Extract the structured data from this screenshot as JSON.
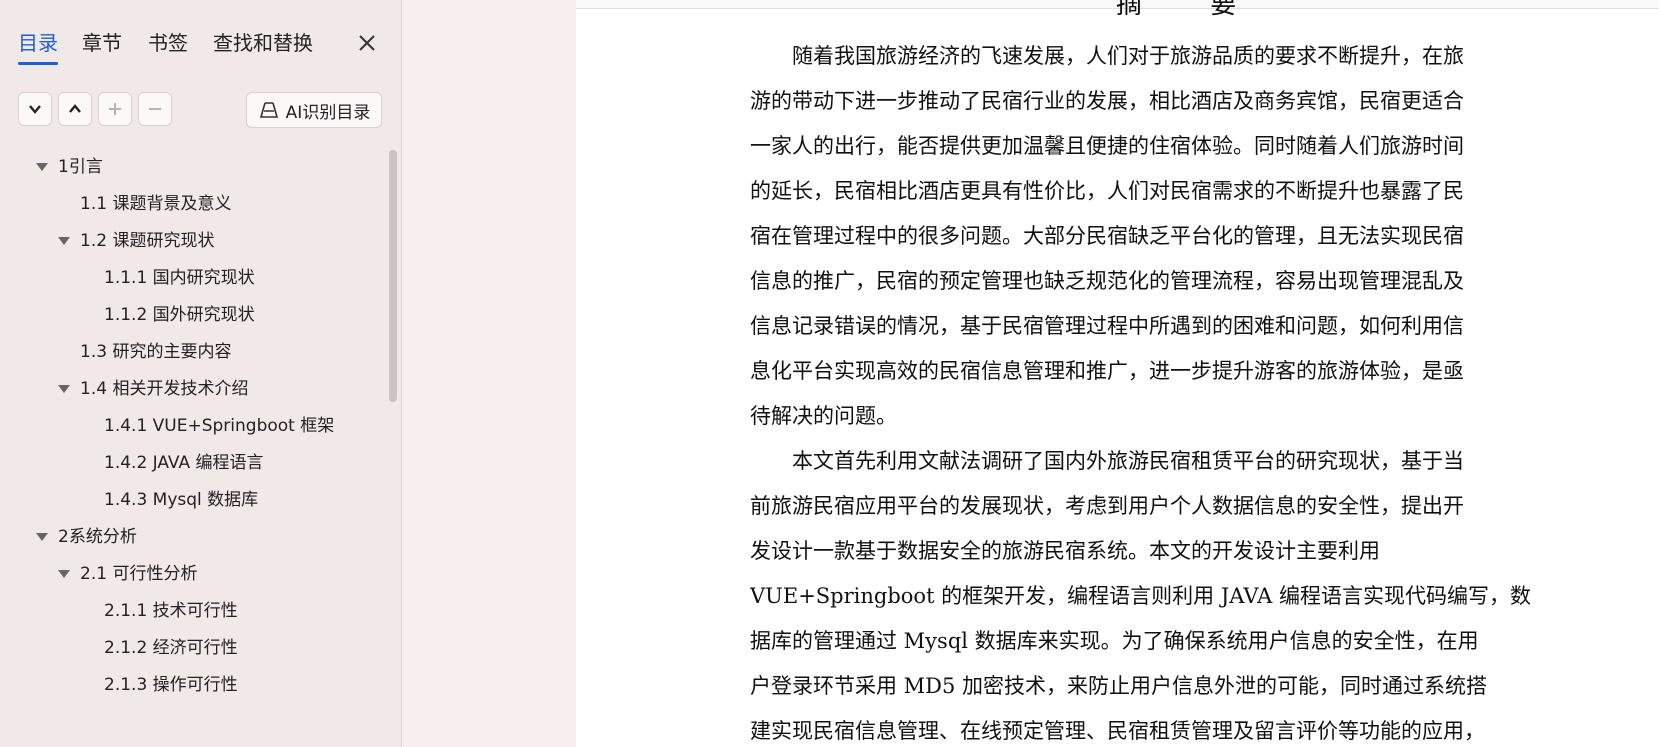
{
  "sidebar": {
    "tabs": [
      {
        "label": "目录"
      },
      {
        "label": "章节"
      },
      {
        "label": "书签"
      },
      {
        "label": "查找和替换"
      }
    ],
    "ai_button_label": "AI识别目录",
    "toc": [
      {
        "label": "1引言"
      },
      {
        "label": "1.1  课题背景及意义"
      },
      {
        "label": "1.2  课题研究现状"
      },
      {
        "label": "1.1.1  国内研究现状"
      },
      {
        "label": "1.1.2  国外研究现状"
      },
      {
        "label": "1.3  研究的主要内容"
      },
      {
        "label": "1.4  相关开发技术介绍"
      },
      {
        "label": "1.4.1 VUE+Springboot 框架"
      },
      {
        "label": "1.4.2 JAVA 编程语言"
      },
      {
        "label": "1.4.3 Mysql 数据库"
      },
      {
        "label": "2系统分析"
      },
      {
        "label": "2.1  可行性分析"
      },
      {
        "label": "2.1.1  技术可行性"
      },
      {
        "label": "2.1.2  经济可行性"
      },
      {
        "label": "2.1.3  操作可行性"
      }
    ]
  },
  "document": {
    "heading": "摘 要",
    "lines": [
      "　　随着我国旅游经济的飞速发展，人们对于旅游品质的要求不断提升，在旅",
      "游的带动下进一步推动了民宿行业的发展，相比酒店及商务宾馆，民宿更适合",
      "一家人的出行，能否提供更加温馨且便捷的住宿体验。同时随着人们旅游时间",
      "的延长，民宿相比酒店更具有性价比，人们对民宿需求的不断提升也暴露了民",
      "宿在管理过程中的很多问题。大部分民宿缺乏平台化的管理，且无法实现民宿",
      "信息的推广，民宿的预定管理也缺乏规范化的管理流程，容易出现管理混乱及",
      "信息记录错误的情况，基于民宿管理过程中所遇到的困难和问题，如何利用信",
      "息化平台实现高效的民宿信息管理和推广，进一步提升游客的旅游体验，是亟",
      "待解决的问题。",
      "　　本文首先利用文献法调研了国内外旅游民宿租赁平台的研究现状，基于当",
      "前旅游民宿应用平台的发展现状，考虑到用户个人数据信息的安全性，提出开",
      "发设计一款基于数据安全的旅游民宿系统。本文的开发设计主要利用",
      "VUE+Springboot 的框架开发，编程语言则利用 JAVA 编程语言实现代码编写，数",
      "据库的管理通过 Mysql 数据库来实现。为了确保系统用户信息的安全性，在用",
      "户登录环节采用 MD5 加密技术，来防止用户信息外泄的可能，同时通过系统搭",
      "建实现民宿信息管理、在线预定管理、民宿租赁管理及留言评价等功能的应用，"
    ]
  },
  "colors": {
    "accent": "#1a5fd6",
    "sidebar_bg": "#f1e8e8"
  }
}
